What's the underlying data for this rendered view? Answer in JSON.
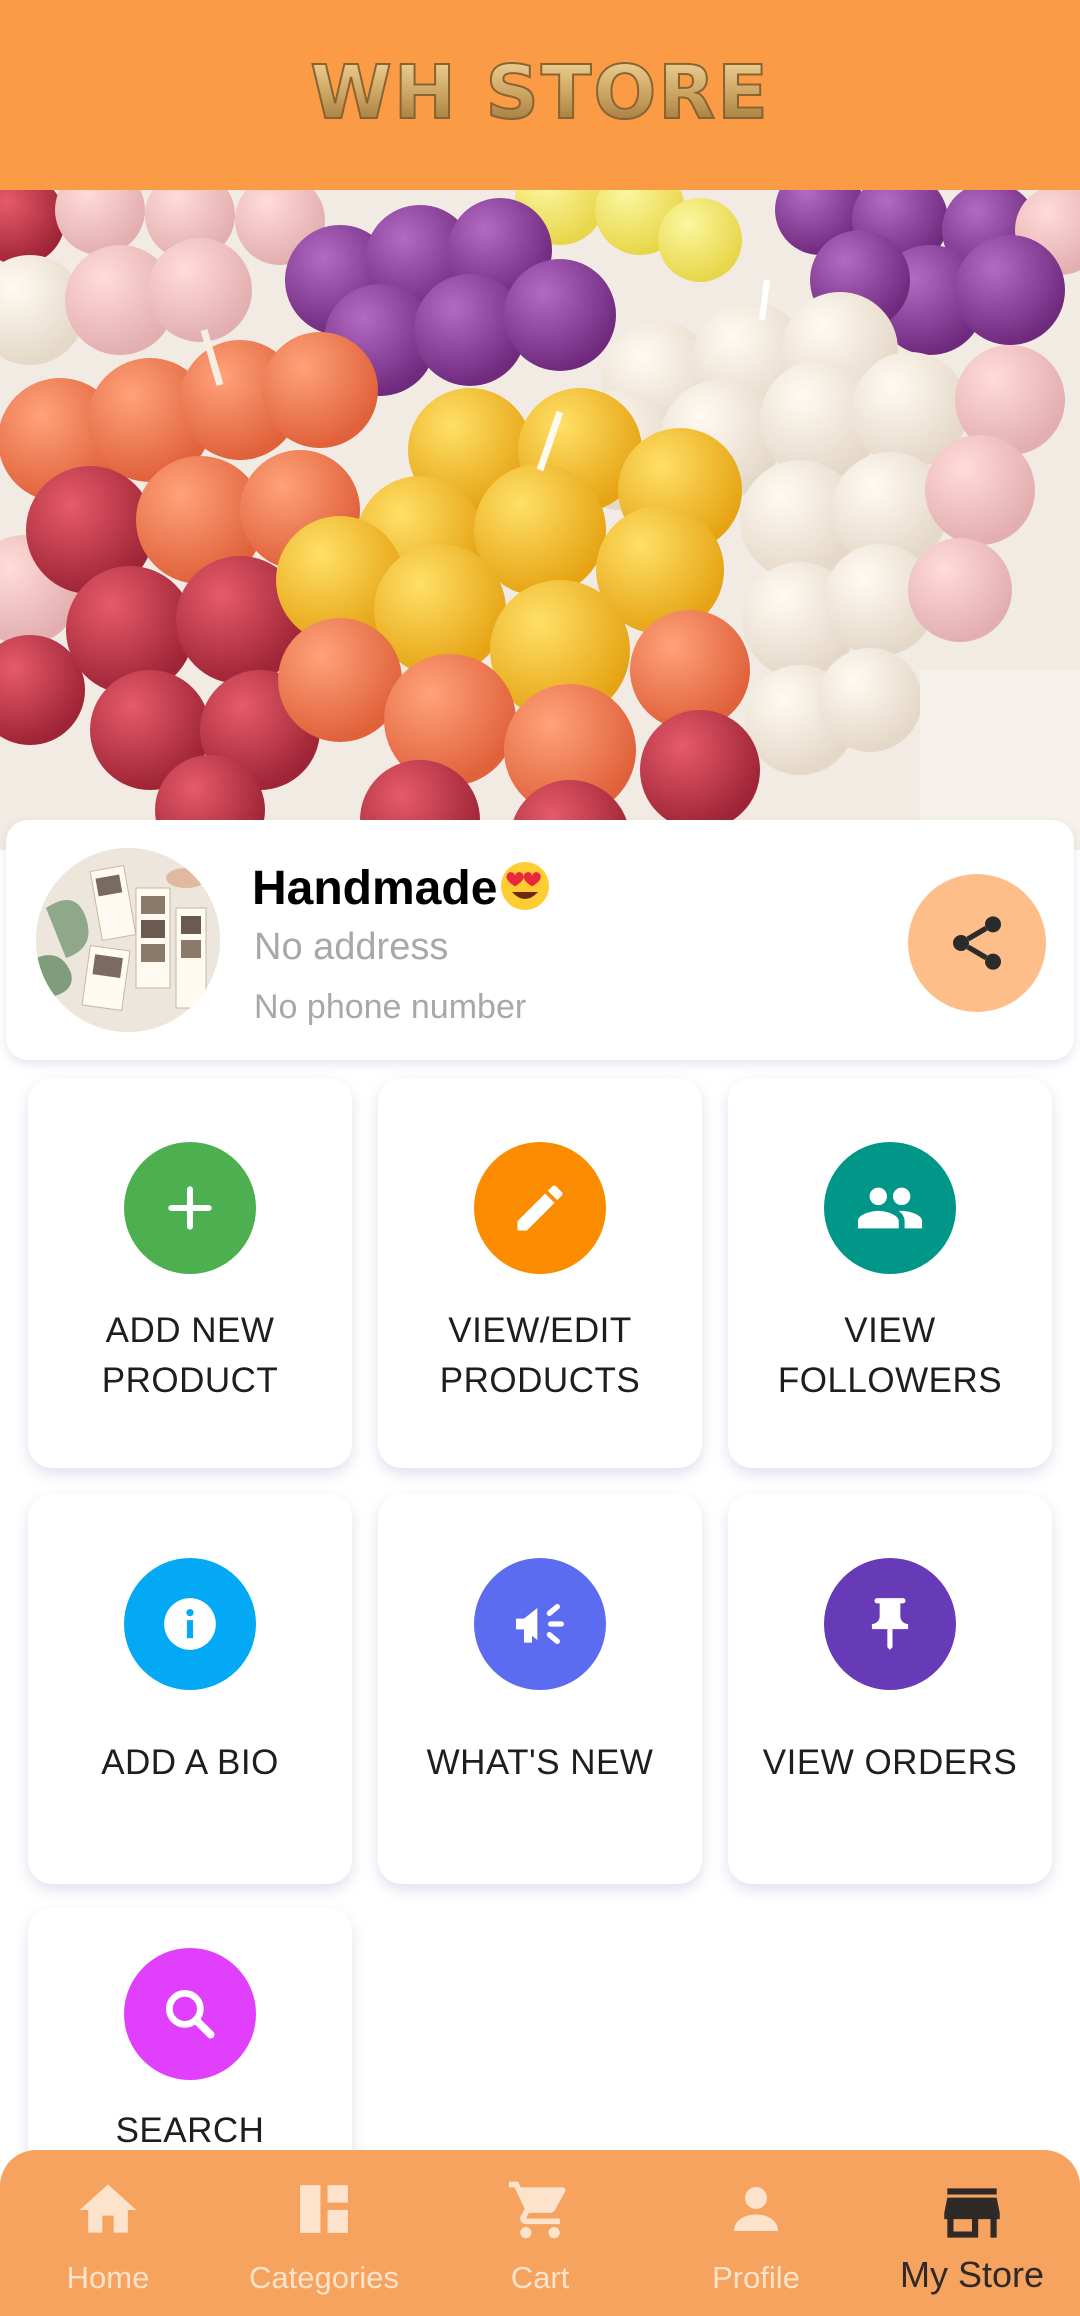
{
  "header": {
    "logo_text": "WH STORE",
    "background": "#fb9b46"
  },
  "banner": {
    "image_alt": "bubble candles"
  },
  "store": {
    "name": "Handmade",
    "name_emoji": "heart-eyes-emoji",
    "address": "No address",
    "phone": "No phone number",
    "share_icon": "share-icon"
  },
  "tiles": [
    {
      "label": "ADD NEW\nPRODUCT",
      "icon": "plus-icon",
      "color": "#4caf50"
    },
    {
      "label": "VIEW/EDIT\nPRODUCTS",
      "icon": "pencil-icon",
      "color": "#fb8c00"
    },
    {
      "label": "VIEW\nFOLLOWERS",
      "icon": "people-icon",
      "color": "#009688"
    },
    {
      "label": "ADD A BIO",
      "icon": "info-icon",
      "color": "#03a9f4"
    },
    {
      "label": "WHAT'S NEW",
      "icon": "megaphone-icon",
      "color": "#5b6cf0"
    },
    {
      "label": "VIEW ORDERS",
      "icon": "pin-icon",
      "color": "#673ab7"
    },
    {
      "label": "SEARCH",
      "icon": "search-icon",
      "color": "#e040fb"
    }
  ],
  "nav": {
    "items": [
      {
        "label": "Home",
        "icon": "home-icon"
      },
      {
        "label": "Categories",
        "icon": "categories-icon"
      },
      {
        "label": "Cart",
        "icon": "cart-icon"
      },
      {
        "label": "Profile",
        "icon": "profile-icon"
      },
      {
        "label": "My Store",
        "icon": "store-icon",
        "active": true
      }
    ]
  }
}
